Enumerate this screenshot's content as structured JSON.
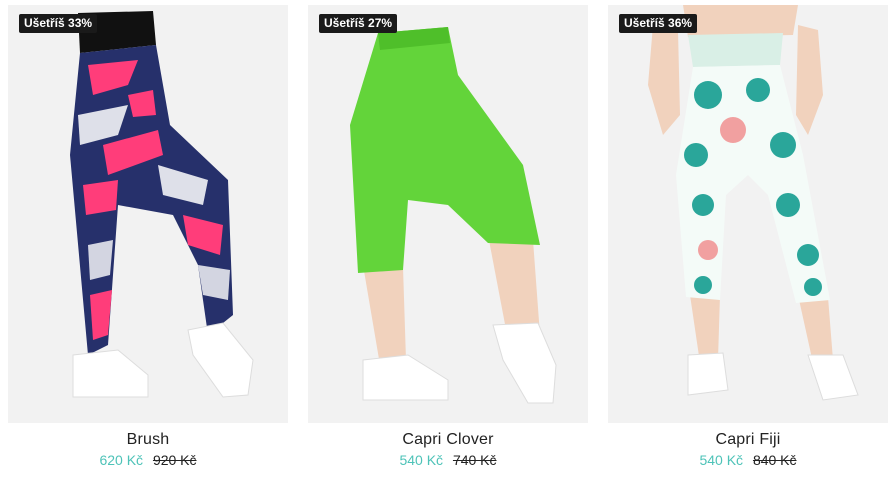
{
  "products": [
    {
      "name": "Brush",
      "badge": "Ušetříš 33%",
      "price": "620 Kč",
      "old_price": "920 Kč",
      "image": "leggings-brush-pattern",
      "colors": {
        "waistband": "#111111",
        "base": "#26306b",
        "accent": "#ff3d7a"
      }
    },
    {
      "name": "Capri Clover",
      "badge": "Ušetříš 27%",
      "price": "540 Kč",
      "old_price": "740 Kč",
      "image": "capri-leggings-green",
      "colors": {
        "base": "#63d43a",
        "accent": "#4fbf2a"
      }
    },
    {
      "name": "Capri Fiji",
      "badge": "Ušetříš 36%",
      "price": "540 Kč",
      "old_price": "840 Kč",
      "image": "capri-leggings-tropical",
      "colors": {
        "waistband": "#d9efe6",
        "base": "#f4fbf8",
        "accent": "#2aa69a",
        "accent2": "#f08a8a"
      }
    }
  ],
  "colors": {
    "price_accent": "#4ec3b8",
    "badge_bg": "#1a1a1a",
    "photo_bg": "#f2f2f2"
  }
}
